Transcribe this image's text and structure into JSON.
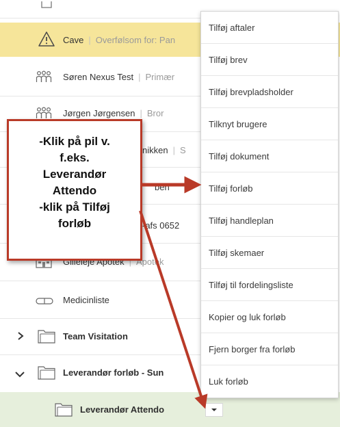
{
  "rows": {
    "cave": {
      "title": "Cave",
      "subtitle": "Overfølsom for: Pan"
    },
    "soren": {
      "name": "Søren Nexus Test",
      "relation": "Primær"
    },
    "jorgen": {
      "name": "Jørgen Jørgensen",
      "relation": "Bror"
    },
    "nikken": {
      "name": "nikken",
      "relation": "S"
    },
    "row_ben": {
      "name": "ben"
    },
    "afs": {
      "name": "-afs 0652"
    },
    "apotek": {
      "name": "Gilleleje Apotek",
      "relation": "Apotek"
    },
    "medicin": {
      "name": "Medicinliste"
    },
    "team": {
      "name": "Team Visitation"
    },
    "leverandor_forlob": {
      "name": "Leverandør forløb - Sun"
    },
    "attendo": {
      "name": "Leverandør Attendo"
    }
  },
  "menu": {
    "items": [
      "Tilføj aftaler",
      "Tilføj brev",
      "Tilføj brevpladsholder",
      "Tilknyt brugere",
      "Tilføj dokument",
      "Tilføj forløb",
      "Tilføj handleplan",
      "Tilføj skemaer",
      "Tilføj til fordelingsliste",
      "Kopier og luk forløb",
      "Fjern borger fra forløb",
      "Luk forløb"
    ]
  },
  "annotation": {
    "lines": [
      "-Klik på pil v.",
      "f.eks.",
      "Leverandør",
      "Attendo",
      "-klik på Tilføj",
      "forløb"
    ]
  },
  "colors": {
    "cave_highlight": "#f6e59a",
    "selected_row": "#e6efdc",
    "annotation_red": "#b93a28"
  },
  "icons": {
    "warning": "warning-icon",
    "people": "people-icon",
    "building": "building-icon",
    "pill": "pill-icon",
    "folder": "folder-icon",
    "chevron_right": "chevron-right-icon",
    "chevron_down": "chevron-down-icon",
    "dropdown": "dropdown-caret-icon"
  }
}
